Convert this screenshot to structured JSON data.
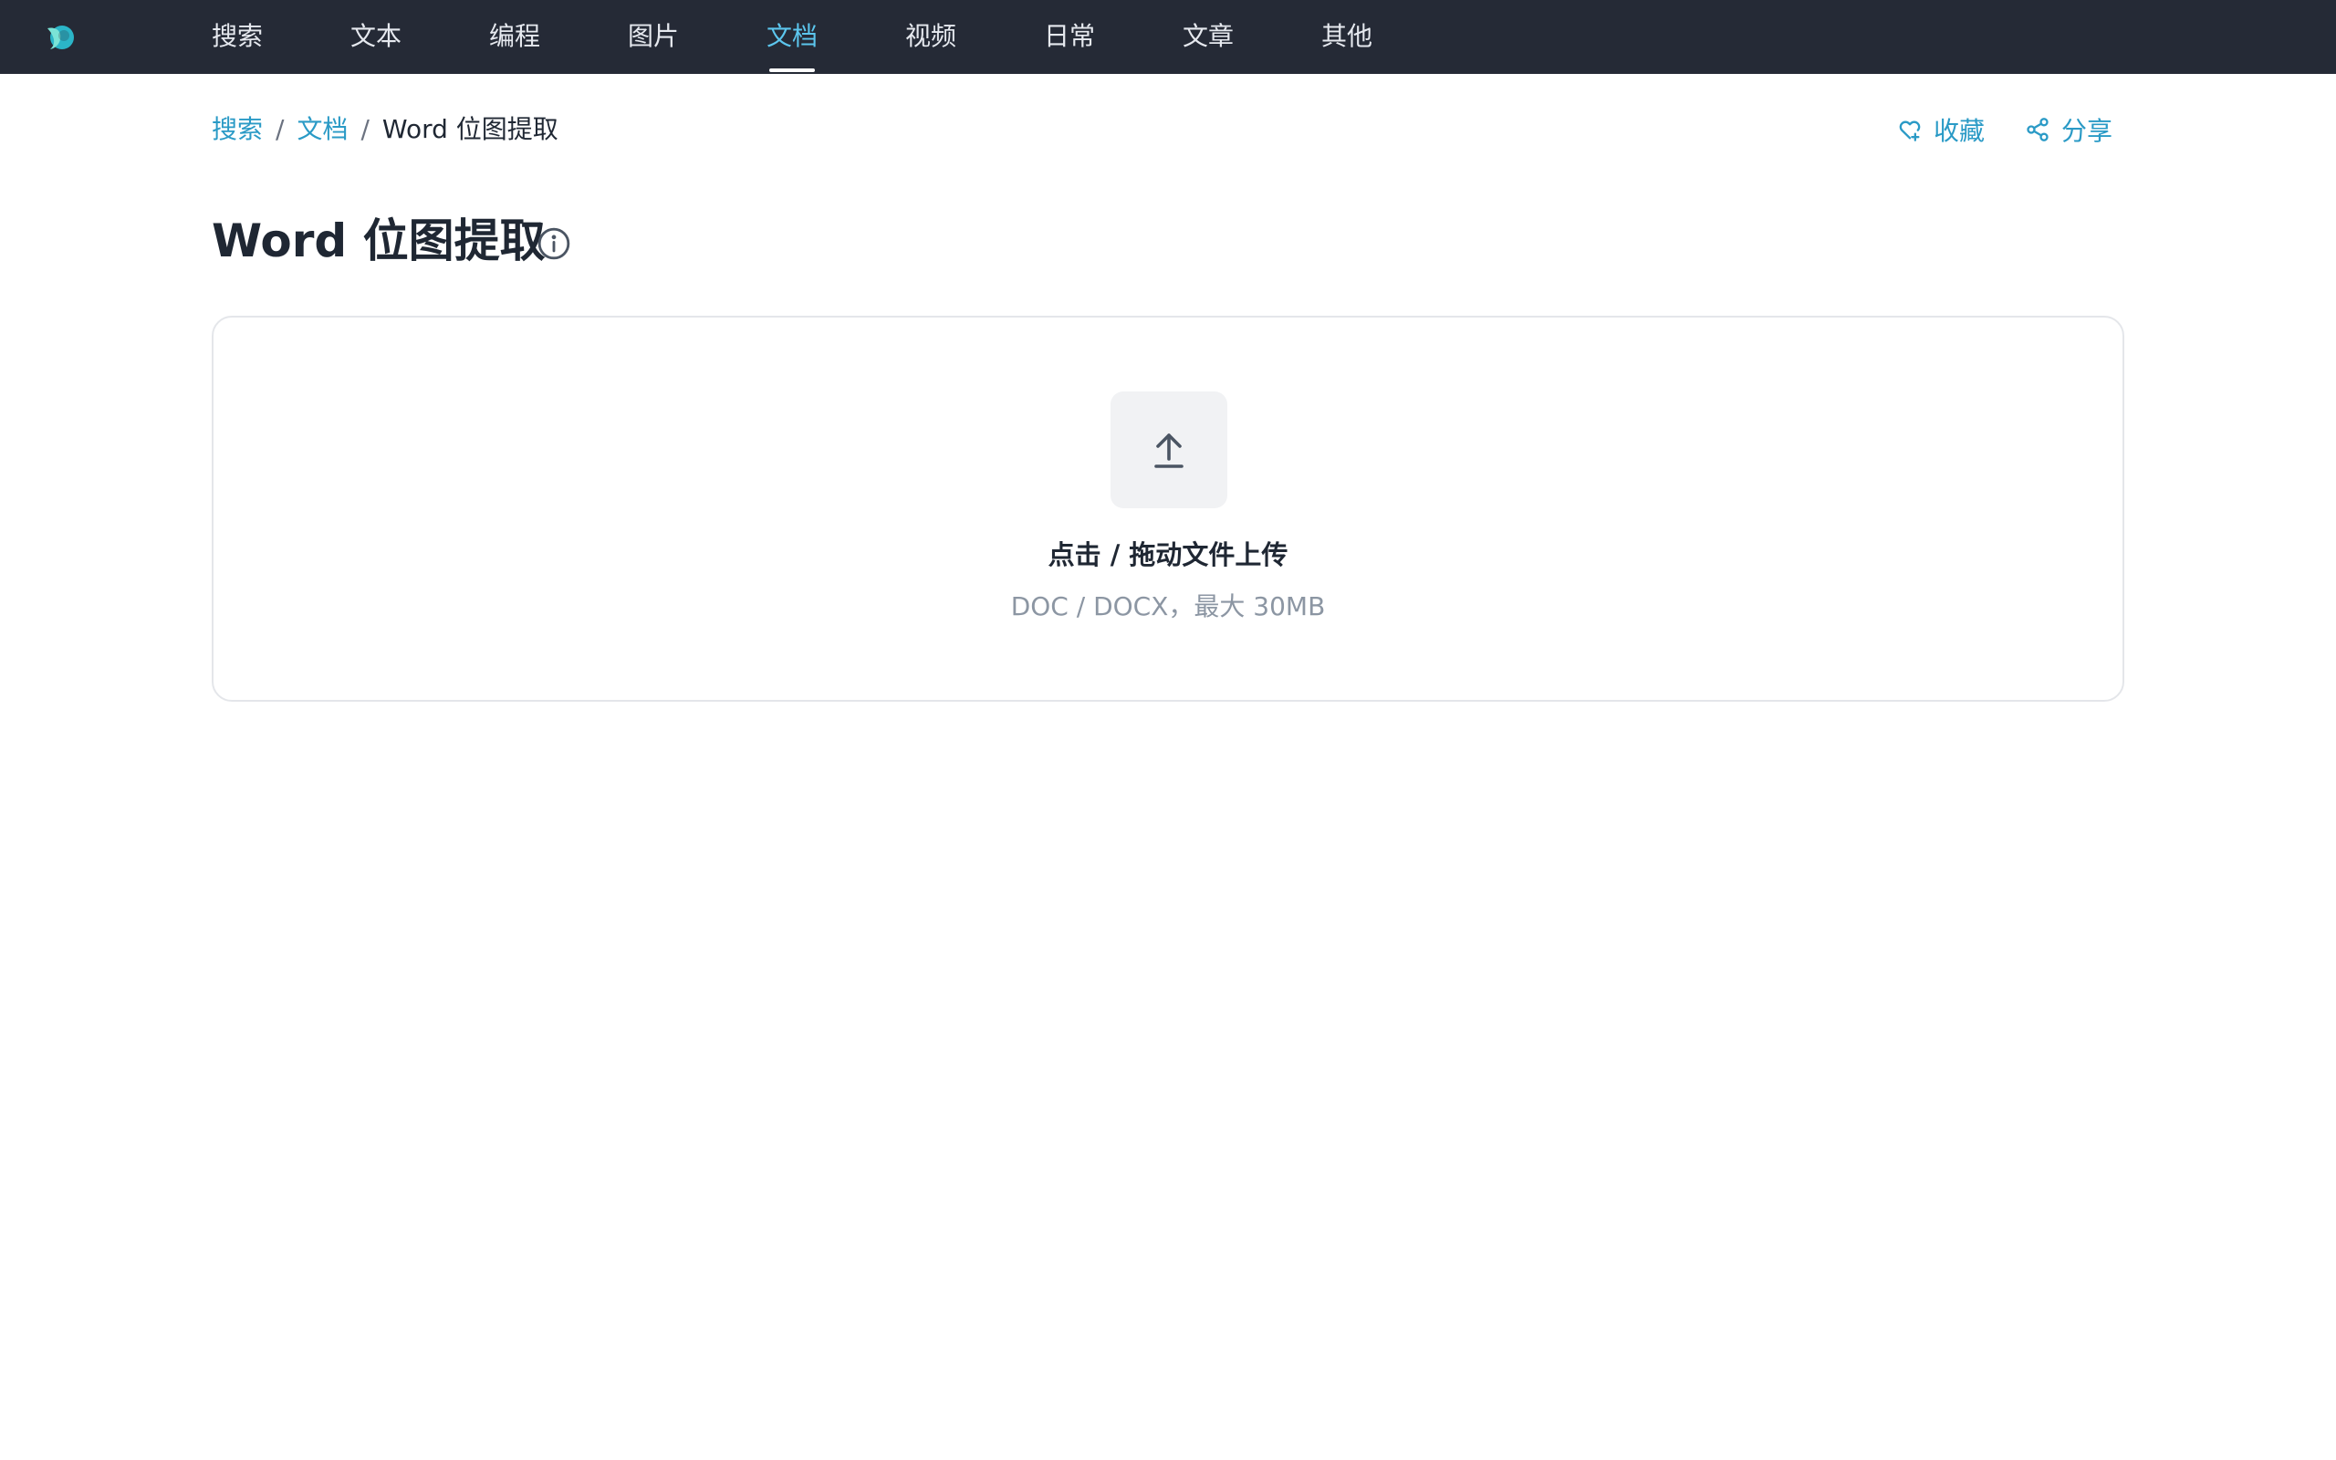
{
  "nav": {
    "items": [
      {
        "label": "搜索"
      },
      {
        "label": "文本"
      },
      {
        "label": "编程"
      },
      {
        "label": "图片"
      },
      {
        "label": "文档",
        "active": true
      },
      {
        "label": "视频"
      },
      {
        "label": "日常"
      },
      {
        "label": "文章"
      },
      {
        "label": "其他"
      }
    ]
  },
  "breadcrumb": {
    "items": [
      "搜索",
      "文档",
      "Word 位图提取"
    ],
    "separator": "/"
  },
  "actions": {
    "favorite_label": "收藏",
    "share_label": "分享"
  },
  "page": {
    "title": "Word 位图提取"
  },
  "upload": {
    "title": "点击 / 拖动文件上传",
    "hint": "DOC / DOCX，最大 30MB"
  },
  "colors": {
    "topbar": "#252a36",
    "accent": "#2a9ac6",
    "nav_active": "#5cc6ee"
  }
}
